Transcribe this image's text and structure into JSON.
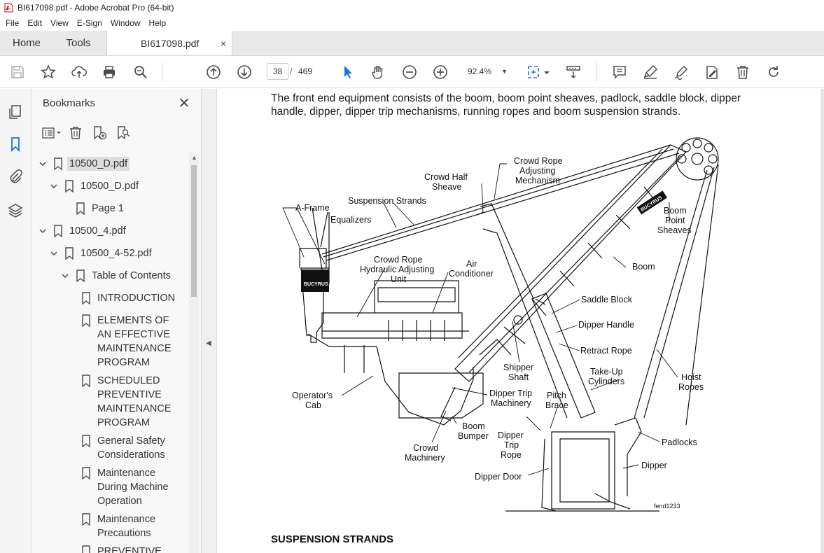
{
  "window": {
    "title": "BI617098.pdf - Adobe Acrobat Pro (64-bit)"
  },
  "menu": [
    "File",
    "Edit",
    "View",
    "E-Sign",
    "Window",
    "Help"
  ],
  "tabs": {
    "home": "Home",
    "tools": "Tools",
    "document": "BI617098.pdf",
    "close_glyph": "×"
  },
  "toolbar": {
    "current_page": "38",
    "page_separator": "/",
    "page_count": "469",
    "zoom": "92.4%",
    "icons": [
      "save-icon",
      "bookmark-star-icon",
      "upload-icon",
      "print-icon",
      "find-icon",
      "prev-page-icon",
      "next-page-icon",
      "select-icon",
      "hand-icon",
      "zoom-out-icon",
      "zoom-in-icon",
      "fit-page-icon",
      "scroll-mode-icon",
      "comment-icon",
      "highlight-icon",
      "sign-icon",
      "edit-icon",
      "delete-icon",
      "rotate-icon"
    ]
  },
  "leftrail": {
    "icons": [
      "pages-icon",
      "bookmarks-icon",
      "attachments-icon",
      "layers-icon"
    ]
  },
  "bookmarks": {
    "title": "Bookmarks",
    "close_glyph": "✕",
    "items": [
      {
        "label": "10500_D.pdf",
        "level": 0,
        "expanded": true,
        "selected": true
      },
      {
        "label": "10500_D.pdf",
        "level": 1,
        "expanded": true
      },
      {
        "label": "Page 1",
        "level": 2
      },
      {
        "label": "10500_4.pdf",
        "level": 0,
        "expanded": true
      },
      {
        "label": "10500_4-52.pdf",
        "level": 1,
        "expanded": true
      },
      {
        "label": "Table of Contents",
        "level": 2,
        "expanded": true
      },
      {
        "label": "INTRODUCTION",
        "level": 3
      },
      {
        "label": "ELEMENTS OF AN EFFECTIVE MAINTENANCE PROGRAM",
        "level": 3
      },
      {
        "label": "SCHEDULED PREVENTIVE MAINTENANCE PROGRAM",
        "level": 3
      },
      {
        "label": "General Safety Considerations",
        "level": 3
      },
      {
        "label": "Maintenance During Machine Operation",
        "level": 3
      },
      {
        "label": "Maintenance Precautions",
        "level": 3
      },
      {
        "label": "PREVENTIVE",
        "level": 3
      }
    ]
  },
  "document": {
    "intro": "The front end equipment consists of the boom, boom point sheaves, padlock, saddle block, dipper handle, dipper, dipper trip mechanisms, running ropes and boom suspension strands.",
    "brand": "BUCYRUS",
    "labels": {
      "crowd_rope_adjusting": [
        "Crowd Rope",
        "Adjusting",
        "Mechanism"
      ],
      "crowd_half_sheave": [
        "Crowd Half",
        "Sheave"
      ],
      "suspension_strands": "Suspension Strands",
      "a_frame": "A-Frame",
      "equalizers": "Equalizers",
      "crowd_rope_hydraulic": [
        "Crowd Rope",
        "Hydraulic Adjusting",
        "Unit"
      ],
      "air_conditioner": [
        "Air",
        "Conditioner"
      ],
      "boom_point_sheaves": [
        "Boom",
        "Point",
        "Sheaves"
      ],
      "boom": "Boom",
      "saddle_block": "Saddle Block",
      "dipper_handle": "Dipper Handle",
      "retract_rope": "Retract Rope",
      "shipper_shaft": [
        "Shipper",
        "Shaft"
      ],
      "take_up_cylinders": [
        "Take-Up",
        "Cylinders"
      ],
      "hoist_ropes": [
        "Hoist",
        "Ropes"
      ],
      "operators_cab": [
        "Operator's",
        "Cab"
      ],
      "dipper_trip_machinery": [
        "Dipper Trip",
        "Machinery"
      ],
      "pitch_brace": [
        "Pitch",
        "Brace"
      ],
      "boom_bumper": [
        "Boom",
        "Bumper"
      ],
      "dipper_trip_rope": [
        "Dipper",
        "Trip",
        "Rope"
      ],
      "crowd_machinery": [
        "Crowd",
        "Machinery"
      ],
      "padlocks": "Padlocks",
      "dipper": "Dipper",
      "dipper_door": "Dipper Door",
      "figure_id": "fend1233"
    },
    "section_heading": "SUSPENSION STRANDS"
  },
  "colors": {
    "accent_blue": "#1473e6",
    "icon_gray": "#4b4b4b",
    "tab_bg": "#e9e9e9",
    "rail_bg": "#f5f5f5"
  }
}
